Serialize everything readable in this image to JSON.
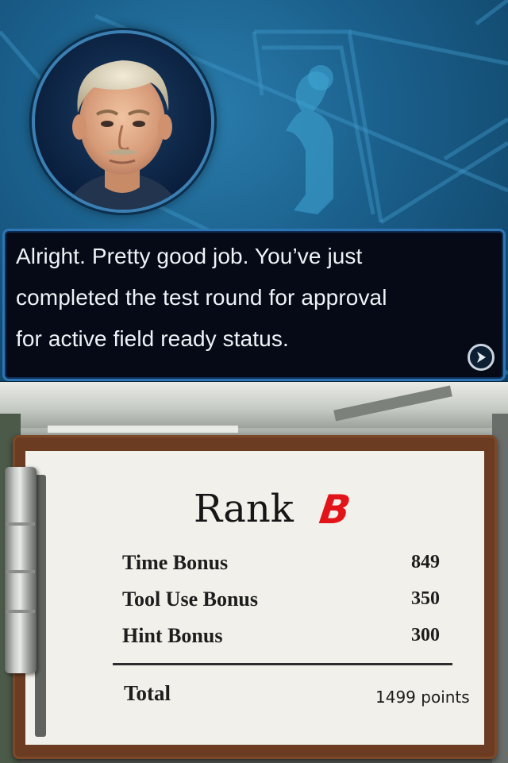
{
  "dialog": {
    "line1": "Alright. Pretty good job. You’ve just",
    "line2": "completed the test round for approval",
    "line3": "for active field ready status."
  },
  "icons": {
    "portrait": "character-portrait",
    "next": "next-arrow-icon",
    "clip": "clipboard-clip"
  },
  "results": {
    "rank_label": "Rank",
    "rank_grade": "B",
    "rows": [
      {
        "name": "Time Bonus",
        "value": "849"
      },
      {
        "name": "Tool Use Bonus",
        "value": "350"
      },
      {
        "name": "Hint Bonus",
        "value": "300"
      }
    ],
    "total_label": "Total",
    "total_value": "1499 points"
  },
  "colors": {
    "dialog_border": "#2f74b4",
    "rank_grade": "#e2141a",
    "clipboard": "#6b3c22"
  }
}
